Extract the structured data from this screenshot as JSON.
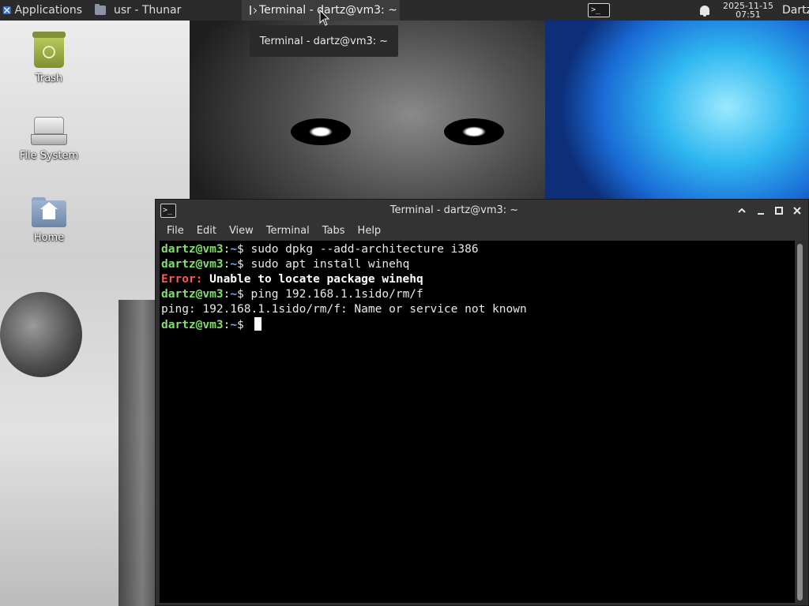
{
  "top_panel": {
    "applications_label": "Applications",
    "tasks": [
      {
        "label": "usr - Thunar",
        "icon": "folder-icon"
      },
      {
        "label": "Terminal - dartz@vm3: ~",
        "icon": "terminal-icon"
      }
    ],
    "clock": {
      "date": "2025-11-15",
      "time": "07:51"
    },
    "user": "Dartz"
  },
  "tooltip": "Terminal - dartz@vm3: ~",
  "desktop_icons": [
    {
      "label": "Trash",
      "icon": "trash-icon"
    },
    {
      "label": "File System",
      "icon": "drive-icon"
    },
    {
      "label": "Home",
      "icon": "home-folder-icon"
    }
  ],
  "terminal": {
    "title": "Terminal - dartz@vm3: ~",
    "menu": [
      "File",
      "Edit",
      "View",
      "Terminal",
      "Tabs",
      "Help"
    ],
    "prompt": {
      "user_host": "dartz@vm3",
      "separator": ":",
      "path": "~",
      "symbol": "$ "
    },
    "lines": [
      {
        "type": "command",
        "text": "sudo dpkg --add-architecture i386"
      },
      {
        "type": "command",
        "text": "sudo apt install winehq"
      },
      {
        "type": "error",
        "label": "Error:",
        "text": " Unable to locate package winehq"
      },
      {
        "type": "command",
        "text": "ping 192.168.1.1sido/rm/f"
      },
      {
        "type": "output",
        "text": "ping: 192.168.1.1sido/rm/f: Name or service not known"
      },
      {
        "type": "prompt",
        "text": ""
      }
    ]
  },
  "colors": {
    "prompt_user": "#7ee26a",
    "prompt_path": "#7aa6e8",
    "error": "#ff5555",
    "terminal_bg": "#000000",
    "panel_bg": "#2b2b2b"
  }
}
